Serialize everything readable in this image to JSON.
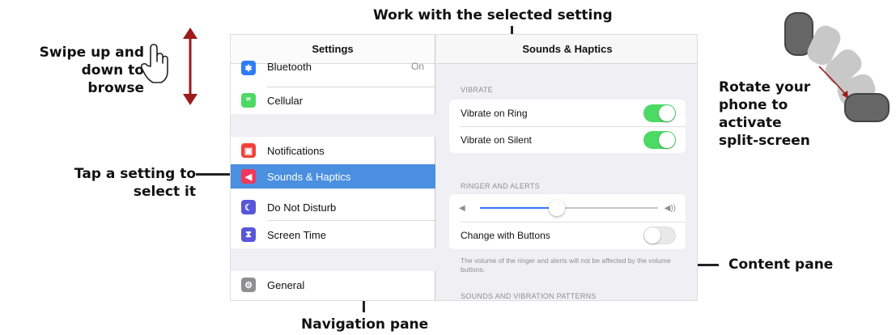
{
  "callouts": {
    "swipe": [
      "Swipe up and",
      "down to browse"
    ],
    "select": [
      "Work with the selected setting"
    ],
    "tap": [
      "Tap a setting to",
      "select it"
    ],
    "rotate": [
      "Rotate your",
      "phone to",
      "activate",
      "split-screen"
    ],
    "content": [
      "Content pane"
    ],
    "navigation": [
      "Navigation pane"
    ]
  },
  "nav": {
    "title": "Settings",
    "items": [
      {
        "label": "Bluetooth",
        "value": "On",
        "icon": "bluetooth-icon",
        "color": "#2f7bf6"
      },
      {
        "label": "Cellular",
        "value": "",
        "icon": "cellular-icon",
        "color": "#4cd964"
      },
      {
        "label": "Notifications",
        "value": "",
        "icon": "notifications-icon",
        "color": "#f0423a"
      },
      {
        "label": "Sounds & Haptics",
        "value": "",
        "icon": "sounds-icon",
        "color": "#f2375b"
      },
      {
        "label": "Do Not Disturb",
        "value": "",
        "icon": "moon-icon",
        "color": "#5856d6"
      },
      {
        "label": "Screen Time",
        "value": "",
        "icon": "hourglass-icon",
        "color": "#5856d6"
      },
      {
        "label": "General",
        "value": "",
        "icon": "gear-icon",
        "color": "#8e8e93"
      }
    ],
    "selected": "Sounds & Haptics"
  },
  "content": {
    "title": "Sounds & Haptics",
    "vibrate_label": "VIBRATE",
    "vibrate_on_ring": {
      "label": "Vibrate on Ring",
      "on": true
    },
    "vibrate_on_silent": {
      "label": "Vibrate on Silent",
      "on": true
    },
    "ringer_label": "RINGER AND ALERTS",
    "ringer_volume": 0.43,
    "change_with_buttons": {
      "label": "Change with Buttons",
      "on": false
    },
    "footnote": "The volume of the ringer and alerts will not be affected by the volume buttons.",
    "patterns_label": "SOUNDS AND VIBRATION PATTERNS"
  },
  "colors": {
    "accent": "#4a8fe0",
    "toggle_on": "#4cd964",
    "arrow": "#9b1b1b",
    "phone_dark": "#666666",
    "phone_light": "#c8c8c8"
  }
}
